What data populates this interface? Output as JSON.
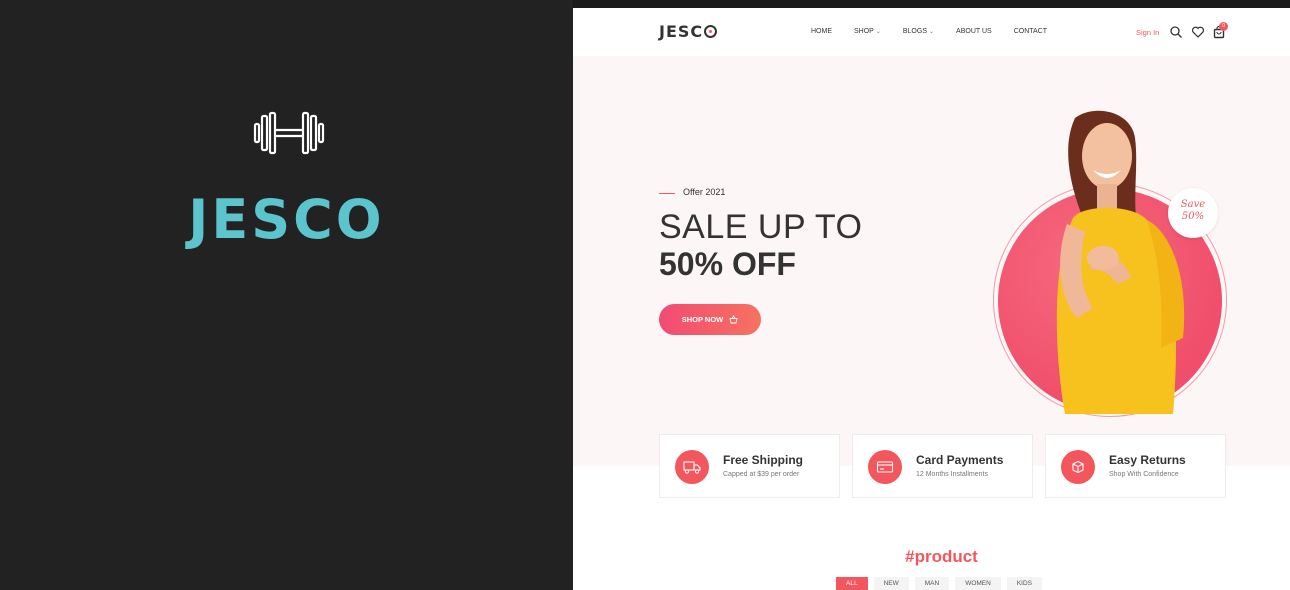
{
  "brand": {
    "icon": "dumbbell-icon",
    "wordmark": "JESCO",
    "wordmark_color": "#5bc4cc"
  },
  "header": {
    "logo": "JESC",
    "logo_o": "O",
    "nav": [
      {
        "label": "HOME",
        "has_dropdown": false
      },
      {
        "label": "SHOP",
        "has_dropdown": true
      },
      {
        "label": "BLOGS",
        "has_dropdown": true
      },
      {
        "label": "ABOUT US",
        "has_dropdown": false
      },
      {
        "label": "CONTACT",
        "has_dropdown": false
      }
    ],
    "sign_in": "Sign In",
    "icons": [
      "search-icon",
      "heart-icon",
      "cart-icon"
    ],
    "cart_count": "0"
  },
  "hero": {
    "offer": "Offer 2021",
    "title_line1": "SALE UP TO",
    "title_line2": "50% OFF",
    "button_label": "SHOP NOW",
    "badge_line1": "Save",
    "badge_line2": "50%"
  },
  "features": [
    {
      "icon": "truck-icon",
      "title": "Free Shipping",
      "subtitle": "Capped at $39 per order"
    },
    {
      "icon": "card-icon",
      "title": "Card Payments",
      "subtitle": "12 Months Installments"
    },
    {
      "icon": "return-box-icon",
      "title": "Easy Returns",
      "subtitle": "Shop With Confidence"
    }
  ],
  "product": {
    "title": "#product",
    "tabs": [
      "ALL",
      "NEW",
      "MAN",
      "WOMEN",
      "KIDS"
    ],
    "active_tab": "ALL"
  },
  "colors": {
    "accent": "#f3565d",
    "dark_panel": "#222222",
    "hero_bg": "#fcf7f6",
    "brand_teal": "#5bc4cc"
  }
}
